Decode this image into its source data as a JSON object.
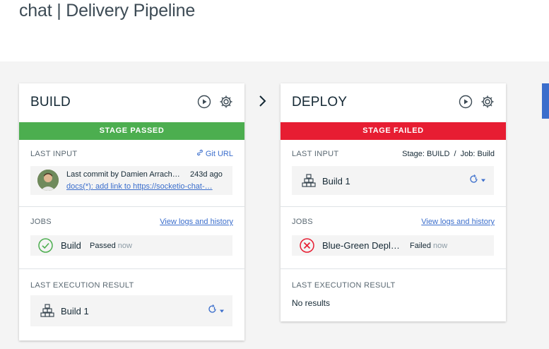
{
  "page": {
    "title": "chat | Delivery Pipeline"
  },
  "stages": {
    "build": {
      "title": "BUILD",
      "status": "STAGE PASSED",
      "last_input": {
        "label": "LAST INPUT",
        "link": "Git URL",
        "commit_text": "Last commit by Damien Arrach…",
        "commit_age": "243d ago",
        "commit_link": "docs(*): add link to https://socketio-chat-…"
      },
      "jobs": {
        "label": "JOBS",
        "link": "View logs and history",
        "items": [
          {
            "name": "Build",
            "status": "Passed",
            "time": "now"
          }
        ]
      },
      "last_execution": {
        "label": "LAST EXECUTION RESULT",
        "item": "Build 1"
      }
    },
    "deploy": {
      "title": "DEPLOY",
      "status": "STAGE FAILED",
      "last_input": {
        "label": "LAST INPUT",
        "meta": "Stage: BUILD  /  Job: Build",
        "item": "Build 1"
      },
      "jobs": {
        "label": "JOBS",
        "link": "View logs and history",
        "items": [
          {
            "name": "Blue-Green Depl…",
            "status": "Failed",
            "time": "now"
          }
        ]
      },
      "last_execution": {
        "label": "LAST EXECUTION RESULT",
        "empty": "No results"
      }
    }
  },
  "colors": {
    "passed": "#4cae4f",
    "failed": "#e71d32",
    "link": "#3b6ecc",
    "canvas": "#f4f4f4"
  },
  "icons": [
    "play-icon",
    "gear-icon",
    "link-icon",
    "avatar",
    "check-circle-icon",
    "error-circle-icon",
    "build-artifact-icon",
    "redeploy-icon",
    "chevron-right-icon"
  ]
}
